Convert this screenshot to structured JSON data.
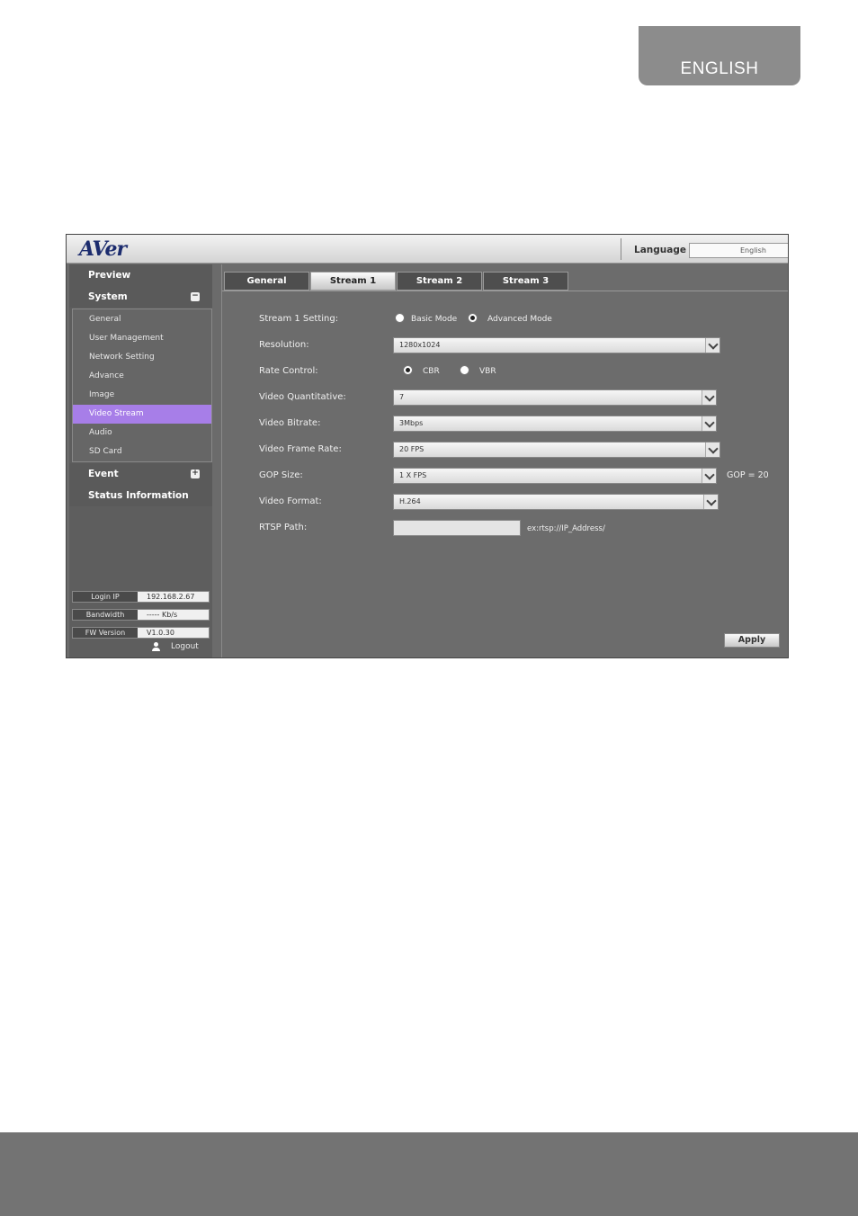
{
  "page_tab": {
    "label": "ENGLISH"
  },
  "app": {
    "logo": "AVer",
    "language": {
      "label": "Language",
      "value": "English"
    },
    "sidebar": {
      "preview": "Preview",
      "system": "System",
      "system_toggle": "−",
      "items": [
        {
          "label": "General"
        },
        {
          "label": "User Management"
        },
        {
          "label": "Network Setting"
        },
        {
          "label": "Advance"
        },
        {
          "label": "Image"
        },
        {
          "label": "Video Stream"
        },
        {
          "label": "Audio"
        },
        {
          "label": "SD Card"
        }
      ],
      "active_item": "Video Stream",
      "event": "Event",
      "event_toggle": "+",
      "status": "Status Information",
      "info": {
        "login_ip_label": "Login IP",
        "login_ip_value": "192.168.2.67",
        "bandwidth_label": "Bandwidth",
        "bandwidth_value": "----- Kb/s",
        "fw_label": "FW Version",
        "fw_value": "V1.0.30"
      },
      "logout": "Logout"
    },
    "tabs": [
      {
        "label": "General"
      },
      {
        "label": "Stream 1"
      },
      {
        "label": "Stream 2"
      },
      {
        "label": "Stream 3"
      }
    ],
    "active_tab": "Stream 1",
    "form": {
      "stream_setting": {
        "label": "Stream 1 Setting:",
        "option_basic": "Basic Mode",
        "option_advanced": "Advanced Mode",
        "selected": "Advanced Mode"
      },
      "resolution": {
        "label": "Resolution:",
        "value": "1280x1024"
      },
      "rate_control": {
        "label": "Rate Control:",
        "option_cbr": "CBR",
        "option_vbr": "VBR",
        "selected": "CBR"
      },
      "quantitative": {
        "label": "Video Quantitative:",
        "value": "7"
      },
      "bitrate": {
        "label": "Video Bitrate:",
        "value": "3Mbps"
      },
      "frame_rate": {
        "label": "Video Frame Rate:",
        "value": "20 FPS"
      },
      "gop": {
        "label": "GOP Size:",
        "value": "1 X FPS",
        "note": "GOP = 20"
      },
      "format": {
        "label": "Video Format:",
        "value": "H.264"
      },
      "rtsp": {
        "label": "RTSP Path:",
        "value": "",
        "hint": "ex:rtsp://IP_Address/"
      }
    },
    "apply": "Apply"
  }
}
